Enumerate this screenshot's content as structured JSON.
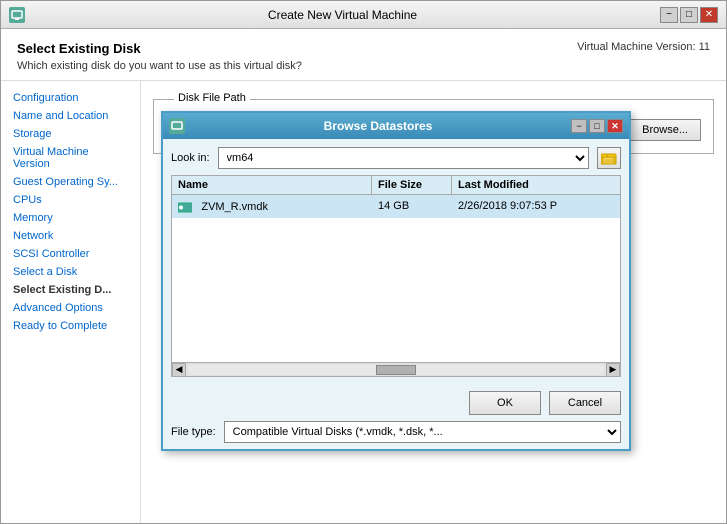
{
  "window": {
    "title": "Create New Virtual Machine",
    "title_icon": "vm-icon",
    "btn_minimize": "−",
    "btn_maximize": "□",
    "btn_close": "✕"
  },
  "header": {
    "title": "Select Existing Disk",
    "subtitle": "Which existing disk do you want to use as this virtual disk?",
    "version": "Virtual Machine Version: 11"
  },
  "sidebar": {
    "items": [
      {
        "label": "Configuration",
        "state": "link"
      },
      {
        "label": "Name and Location",
        "state": "link"
      },
      {
        "label": "Storage",
        "state": "link"
      },
      {
        "label": "Virtual Machine Version",
        "state": "link"
      },
      {
        "label": "Guest Operating Sy...",
        "state": "link"
      },
      {
        "label": "CPUs",
        "state": "link"
      },
      {
        "label": "Memory",
        "state": "link"
      },
      {
        "label": "Network",
        "state": "link"
      },
      {
        "label": "SCSI Controller",
        "state": "link"
      },
      {
        "label": "Select a Disk",
        "state": "link"
      },
      {
        "label": "Select Existing D...",
        "state": "active"
      },
      {
        "label": "Advanced Options",
        "state": "link"
      },
      {
        "label": "Ready to Complete",
        "state": "link"
      }
    ]
  },
  "disk_file_path": {
    "legend": "Disk File Path",
    "input_value": "",
    "input_placeholder": "",
    "browse_btn": "Browse..."
  },
  "browse_dialog": {
    "title": "Browse Datastores",
    "title_icon": "datastore-icon",
    "btn_minimize": "−",
    "btn_maximize": "□",
    "btn_close": "✕",
    "look_in_label": "Look in:",
    "look_in_value": "vm64",
    "columns": [
      {
        "label": "Name",
        "key": "name"
      },
      {
        "label": "File Size",
        "key": "size"
      },
      {
        "label": "Last Modified",
        "key": "modified"
      }
    ],
    "files": [
      {
        "name": "ZVM_R.vmdk",
        "size": "14 GB",
        "modified": "2/26/2018 9:07:53 P"
      }
    ],
    "file_type_label": "File type:",
    "file_type_value": "Compatible Virtual Disks (*.vmdk, *.dsk, *...",
    "ok_btn": "OK",
    "cancel_btn": "Cancel"
  }
}
